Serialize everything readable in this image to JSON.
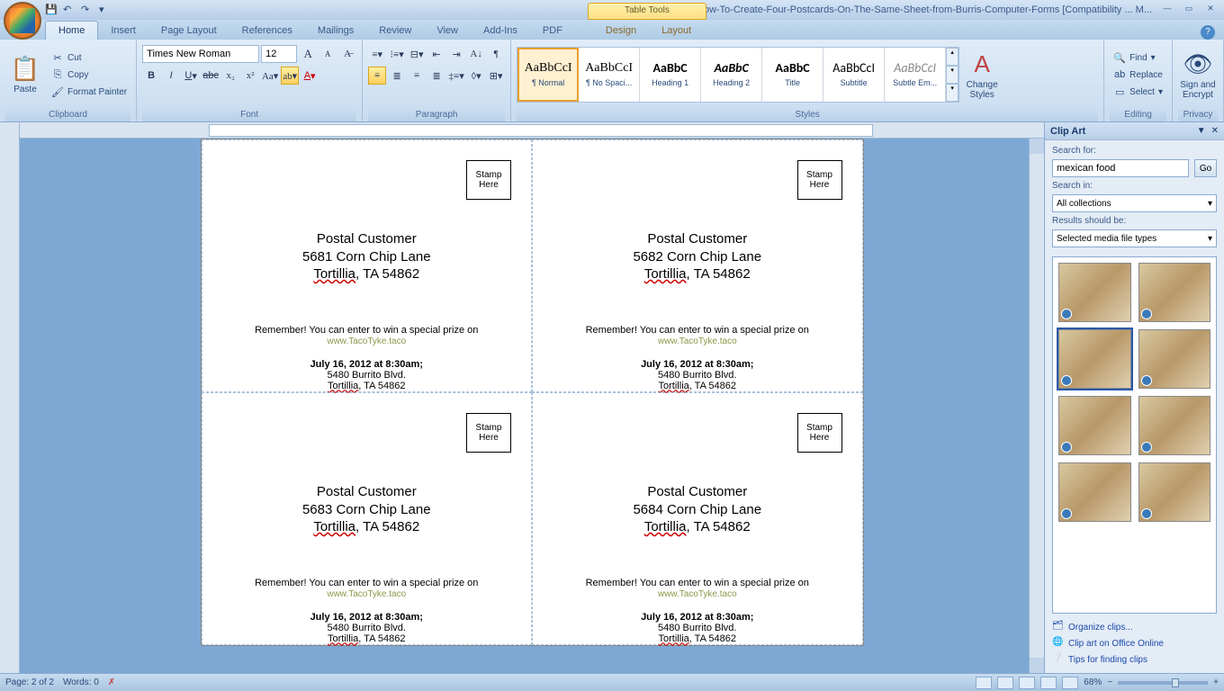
{
  "title": {
    "context_tools": "Table Tools",
    "document": "How-To-Create-Four-Postcards-On-The-Same-Sheet-from-Burris-Computer-Forms [Compatibility ... M..."
  },
  "tabs": {
    "home": "Home",
    "insert": "Insert",
    "page_layout": "Page Layout",
    "references": "References",
    "mailings": "Mailings",
    "review": "Review",
    "view": "View",
    "addins": "Add-Ins",
    "pdf": "PDF",
    "design": "Design",
    "layout": "Layout"
  },
  "clipboard": {
    "label": "Clipboard",
    "paste": "Paste",
    "cut": "Cut",
    "copy": "Copy",
    "format_painter": "Format Painter"
  },
  "font": {
    "label": "Font",
    "name": "Times New Roman",
    "size": "12"
  },
  "paragraph": {
    "label": "Paragraph"
  },
  "styles": {
    "label": "Styles",
    "change": "Change Styles",
    "items": [
      {
        "nm": "¶ Normal",
        "prev": "AaBbCcI",
        "fam": "serif",
        "ital": false,
        "col": "#000"
      },
      {
        "nm": "¶ No Spaci...",
        "prev": "AaBbCcI",
        "fam": "serif",
        "ital": false,
        "col": "#000"
      },
      {
        "nm": "Heading 1",
        "prev": "AaBbC",
        "fam": "sans",
        "ital": false,
        "col": "#000",
        "bold": true
      },
      {
        "nm": "Heading 2",
        "prev": "AaBbC",
        "fam": "sans",
        "ital": true,
        "col": "#000",
        "bold": true
      },
      {
        "nm": "Title",
        "prev": "AaBbC",
        "fam": "sans",
        "ital": false,
        "col": "#000",
        "bold": true
      },
      {
        "nm": "Subtitle",
        "prev": "AaBbCcI",
        "fam": "sans",
        "ital": false,
        "col": "#000"
      },
      {
        "nm": "Subtle Em...",
        "prev": "AaBbCcI",
        "fam": "sans",
        "ital": true,
        "col": "#888"
      }
    ]
  },
  "editing": {
    "label": "Editing",
    "find": "Find",
    "replace": "Replace",
    "select": "Select"
  },
  "privacy": {
    "label": "Privacy",
    "sign": "Sign and Encrypt"
  },
  "postcards": [
    {
      "name": "Postal Customer",
      "addr1": "5681 Corn Chip Lane",
      "city": "Tortillia, TA 54862"
    },
    {
      "name": "Postal Customer",
      "addr1": "5682 Corn Chip Lane",
      "city": "Tortillia, TA 54862"
    },
    {
      "name": "Postal Customer",
      "addr1": "5683 Corn Chip Lane",
      "city": "Tortillia, TA 54862"
    },
    {
      "name": "Postal Customer",
      "addr1": "5684 Corn Chip Lane",
      "city": "Tortillia, TA 54862"
    }
  ],
  "postcard_common": {
    "stamp": "Stamp Here",
    "remember": "Remember! You can enter to win a special prize on",
    "link": "www.TacoTyke.taco",
    "date": "July 16, 2012 at 8:30am;",
    "event_addr": "5480 Burrito Blvd.",
    "event_city": "Tortillia, TA 54862"
  },
  "clipart": {
    "title": "Clip Art",
    "search_for": "Search for:",
    "search_value": "mexican food",
    "go": "Go",
    "search_in": "Search in:",
    "search_in_value": "All collections",
    "results_be": "Results should be:",
    "results_value": "Selected media file types",
    "link1": "Organize clips...",
    "link2": "Clip art on Office Online",
    "link3": "Tips for finding clips"
  },
  "status": {
    "page": "Page: 2 of 2",
    "words": "Words: 0",
    "zoom": "68%"
  }
}
